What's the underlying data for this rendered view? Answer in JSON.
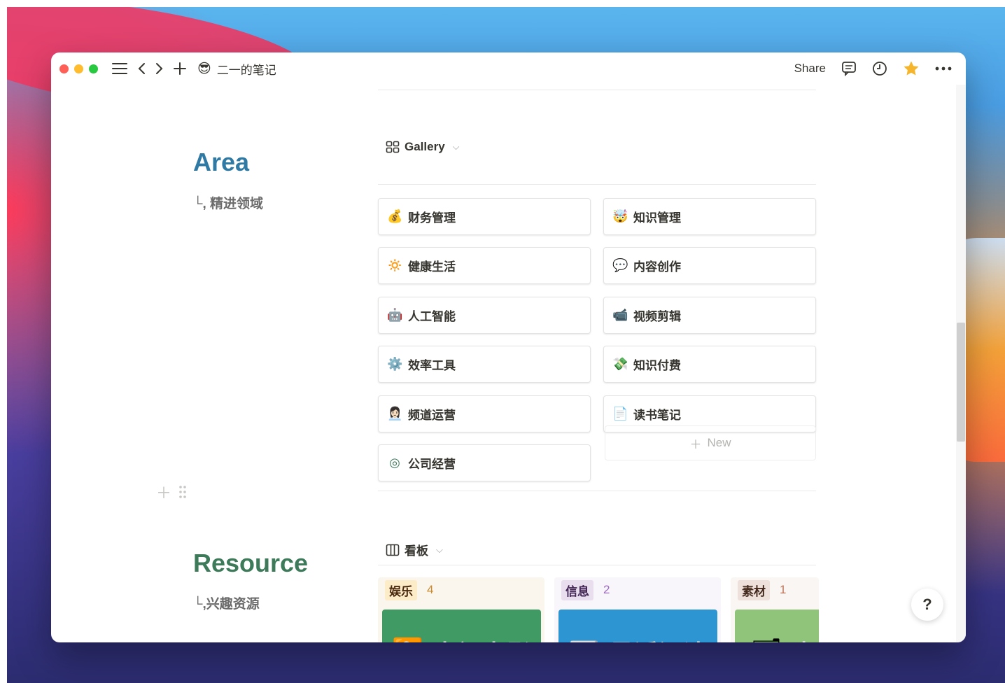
{
  "titlebar": {
    "page_emoji": "😎",
    "page_title": "二一的笔记",
    "share_label": "Share"
  },
  "area": {
    "title": "Area",
    "subtitle": "└, 精进领域",
    "view": {
      "icon": "gallery-icon",
      "label": "Gallery"
    },
    "cards": [
      {
        "emoji": "💰",
        "label": "财务管理"
      },
      {
        "emoji": "🤯",
        "label": "知识管理"
      },
      {
        "emoji": "🔅",
        "label": "健康生活"
      },
      {
        "emoji": "💬",
        "label": "内容创作"
      },
      {
        "emoji": "🤖",
        "label": "人工智能"
      },
      {
        "emoji": "📹",
        "label": "视频剪辑"
      },
      {
        "emoji": "⚙️",
        "label": "效率工具"
      },
      {
        "emoji": "💸",
        "label": "知识付费"
      },
      {
        "emoji": "👩🏻‍💼",
        "label": "频道运营"
      },
      {
        "emoji": "📄",
        "label": "读书笔记"
      },
      {
        "emoji": "◎",
        "label": "公司经营"
      }
    ],
    "new_label": "New"
  },
  "resource": {
    "title": "Resource",
    "subtitle": "└,兴趣资源",
    "view": {
      "icon": "board-icon",
      "label": "看板"
    },
    "columns": [
      {
        "tag": "娱乐",
        "count": "4",
        "tag_bg": "#fdecc8",
        "tag_color": "#49290e",
        "count_color": "#c88a2a",
        "col_bg": "#faf6ee",
        "card_title": "电视电影",
        "card_icon": "🎦",
        "card_bg": "#3f9a64"
      },
      {
        "tag": "信息",
        "count": "2",
        "tag_bg": "#e8deee",
        "tag_color": "#412454",
        "count_color": "#9a6dbd",
        "col_bg": "#f8f5fb",
        "card_title": "最近阅读",
        "card_icon": "📰",
        "card_bg": "#2e95d3"
      },
      {
        "tag": "素材",
        "count": "1",
        "tag_bg": "#eee0da",
        "tag_color": "#442a1e",
        "count_color": "#c0775b",
        "col_bg": "#faf6f4",
        "card_title": "素",
        "card_icon": "🗂",
        "card_bg": "#8fc47a"
      }
    ]
  },
  "help_label": "?"
}
